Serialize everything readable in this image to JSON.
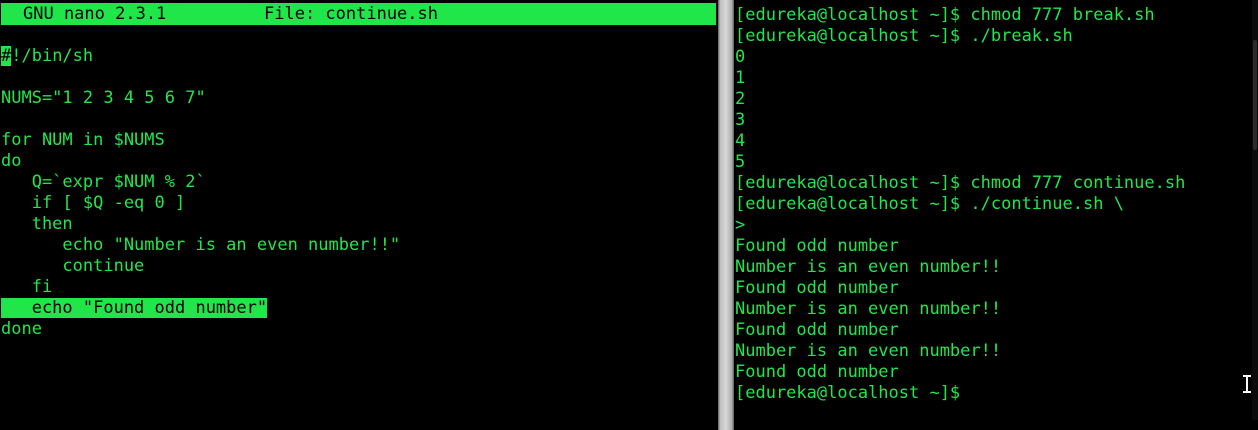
{
  "nano": {
    "version": "GNU nano 2.3.1",
    "file": "File: continue.sh",
    "cursor_char": "#",
    "lines": [
      "!/bin/sh",
      "",
      "NUMS=\"1 2 3 4 5 6 7\"",
      "",
      "for NUM in $NUMS",
      "do",
      "   Q=`expr $NUM % 2`",
      "   if [ $Q -eq 0 ]",
      "   then",
      "      echo \"Number is an even number!!\"",
      "      continue",
      "   fi",
      "   echo \"Found odd number\"",
      "done"
    ],
    "highlighted_line_index": 12
  },
  "terminal": {
    "lines": [
      "[edureka@localhost ~]$ chmod 777 break.sh",
      "[edureka@localhost ~]$ ./break.sh",
      "0",
      "1",
      "2",
      "3",
      "4",
      "5",
      "[edureka@localhost ~]$ chmod 777 continue.sh",
      "[edureka@localhost ~]$ ./continue.sh \\",
      ">",
      "Found odd number",
      "Number is an even number!!",
      "Found odd number",
      "Number is an even number!!",
      "Found odd number",
      "Number is an even number!!",
      "Found odd number",
      "[edureka@localhost ~]$"
    ]
  },
  "colors": {
    "terminal_green": "#21e64a",
    "background": "#000000"
  }
}
